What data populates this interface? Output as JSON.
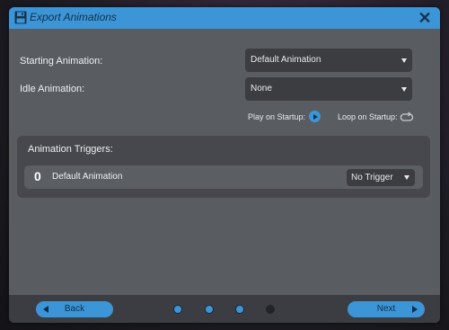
{
  "window": {
    "title": "Export Animations",
    "close_icon": "close-icon"
  },
  "settings": {
    "starting_animation_label": "Starting Animation:",
    "starting_animation_value": "Default Animation",
    "idle_animation_label": "Idle Animation:",
    "idle_animation_value": "None",
    "play_on_startup_label": "Play on Startup:",
    "play_on_startup_enabled": true,
    "loop_on_startup_label": "Loop on Startup:",
    "loop_on_startup_enabled": false
  },
  "triggers": {
    "title": "Animation Triggers:",
    "rows": [
      {
        "index": "0",
        "name": "Default Animation",
        "trigger": "No Trigger"
      }
    ]
  },
  "footer": {
    "back_label": "Back",
    "next_label": "Next",
    "steps": [
      true,
      true,
      true,
      false
    ]
  },
  "colors": {
    "accent": "#3c95d6",
    "dialog_bg": "#595c61",
    "panel_bg": "#46484d",
    "control_bg": "#3b3d41"
  }
}
